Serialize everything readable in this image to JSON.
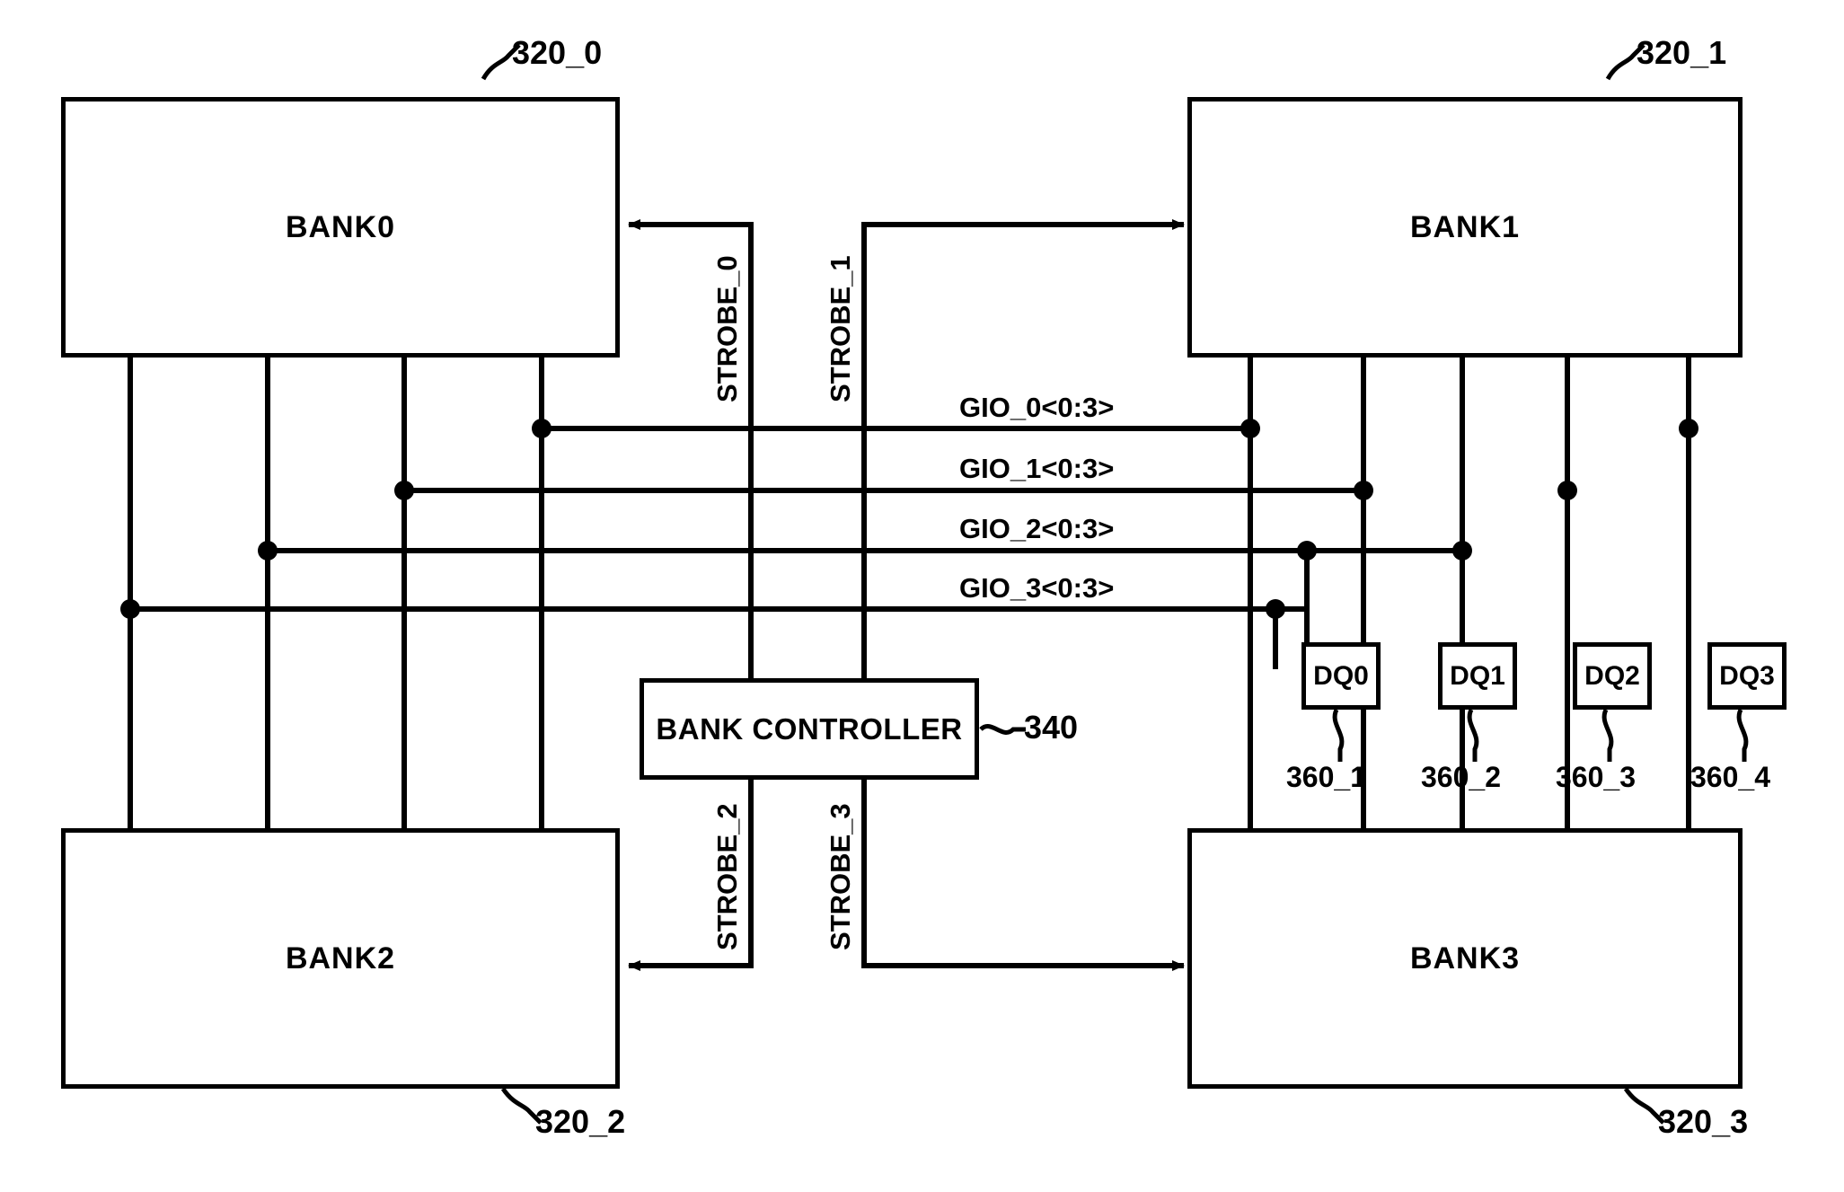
{
  "figure": {
    "type": "memory-bank-block-diagram",
    "banks": [
      {
        "id": "bank0",
        "label": "BANK0",
        "ref": "320_0"
      },
      {
        "id": "bank1",
        "label": "BANK1",
        "ref": "320_1"
      },
      {
        "id": "bank2",
        "label": "BANK2",
        "ref": "320_2"
      },
      {
        "id": "bank3",
        "label": "BANK3",
        "ref": "320_3"
      }
    ],
    "controller": {
      "label": "BANK CONTROLLER",
      "ref": "340"
    },
    "dq_pads": [
      {
        "label": "DQ0",
        "ref": "360_1"
      },
      {
        "label": "DQ1",
        "ref": "360_2"
      },
      {
        "label": "DQ2",
        "ref": "360_3"
      },
      {
        "label": "DQ3",
        "ref": "360_4"
      }
    ],
    "gio_buses": [
      {
        "label": "GIO_0<0:3>"
      },
      {
        "label": "GIO_1<0:3>"
      },
      {
        "label": "GIO_2<0:3>"
      },
      {
        "label": "GIO_3<0:3>"
      }
    ],
    "strobes": [
      {
        "label": "STROBE_0"
      },
      {
        "label": "STROBE_1"
      },
      {
        "label": "STROBE_2"
      },
      {
        "label": "STROBE_3"
      }
    ],
    "colors": {
      "line": "#000000",
      "background": "#ffffff"
    }
  }
}
